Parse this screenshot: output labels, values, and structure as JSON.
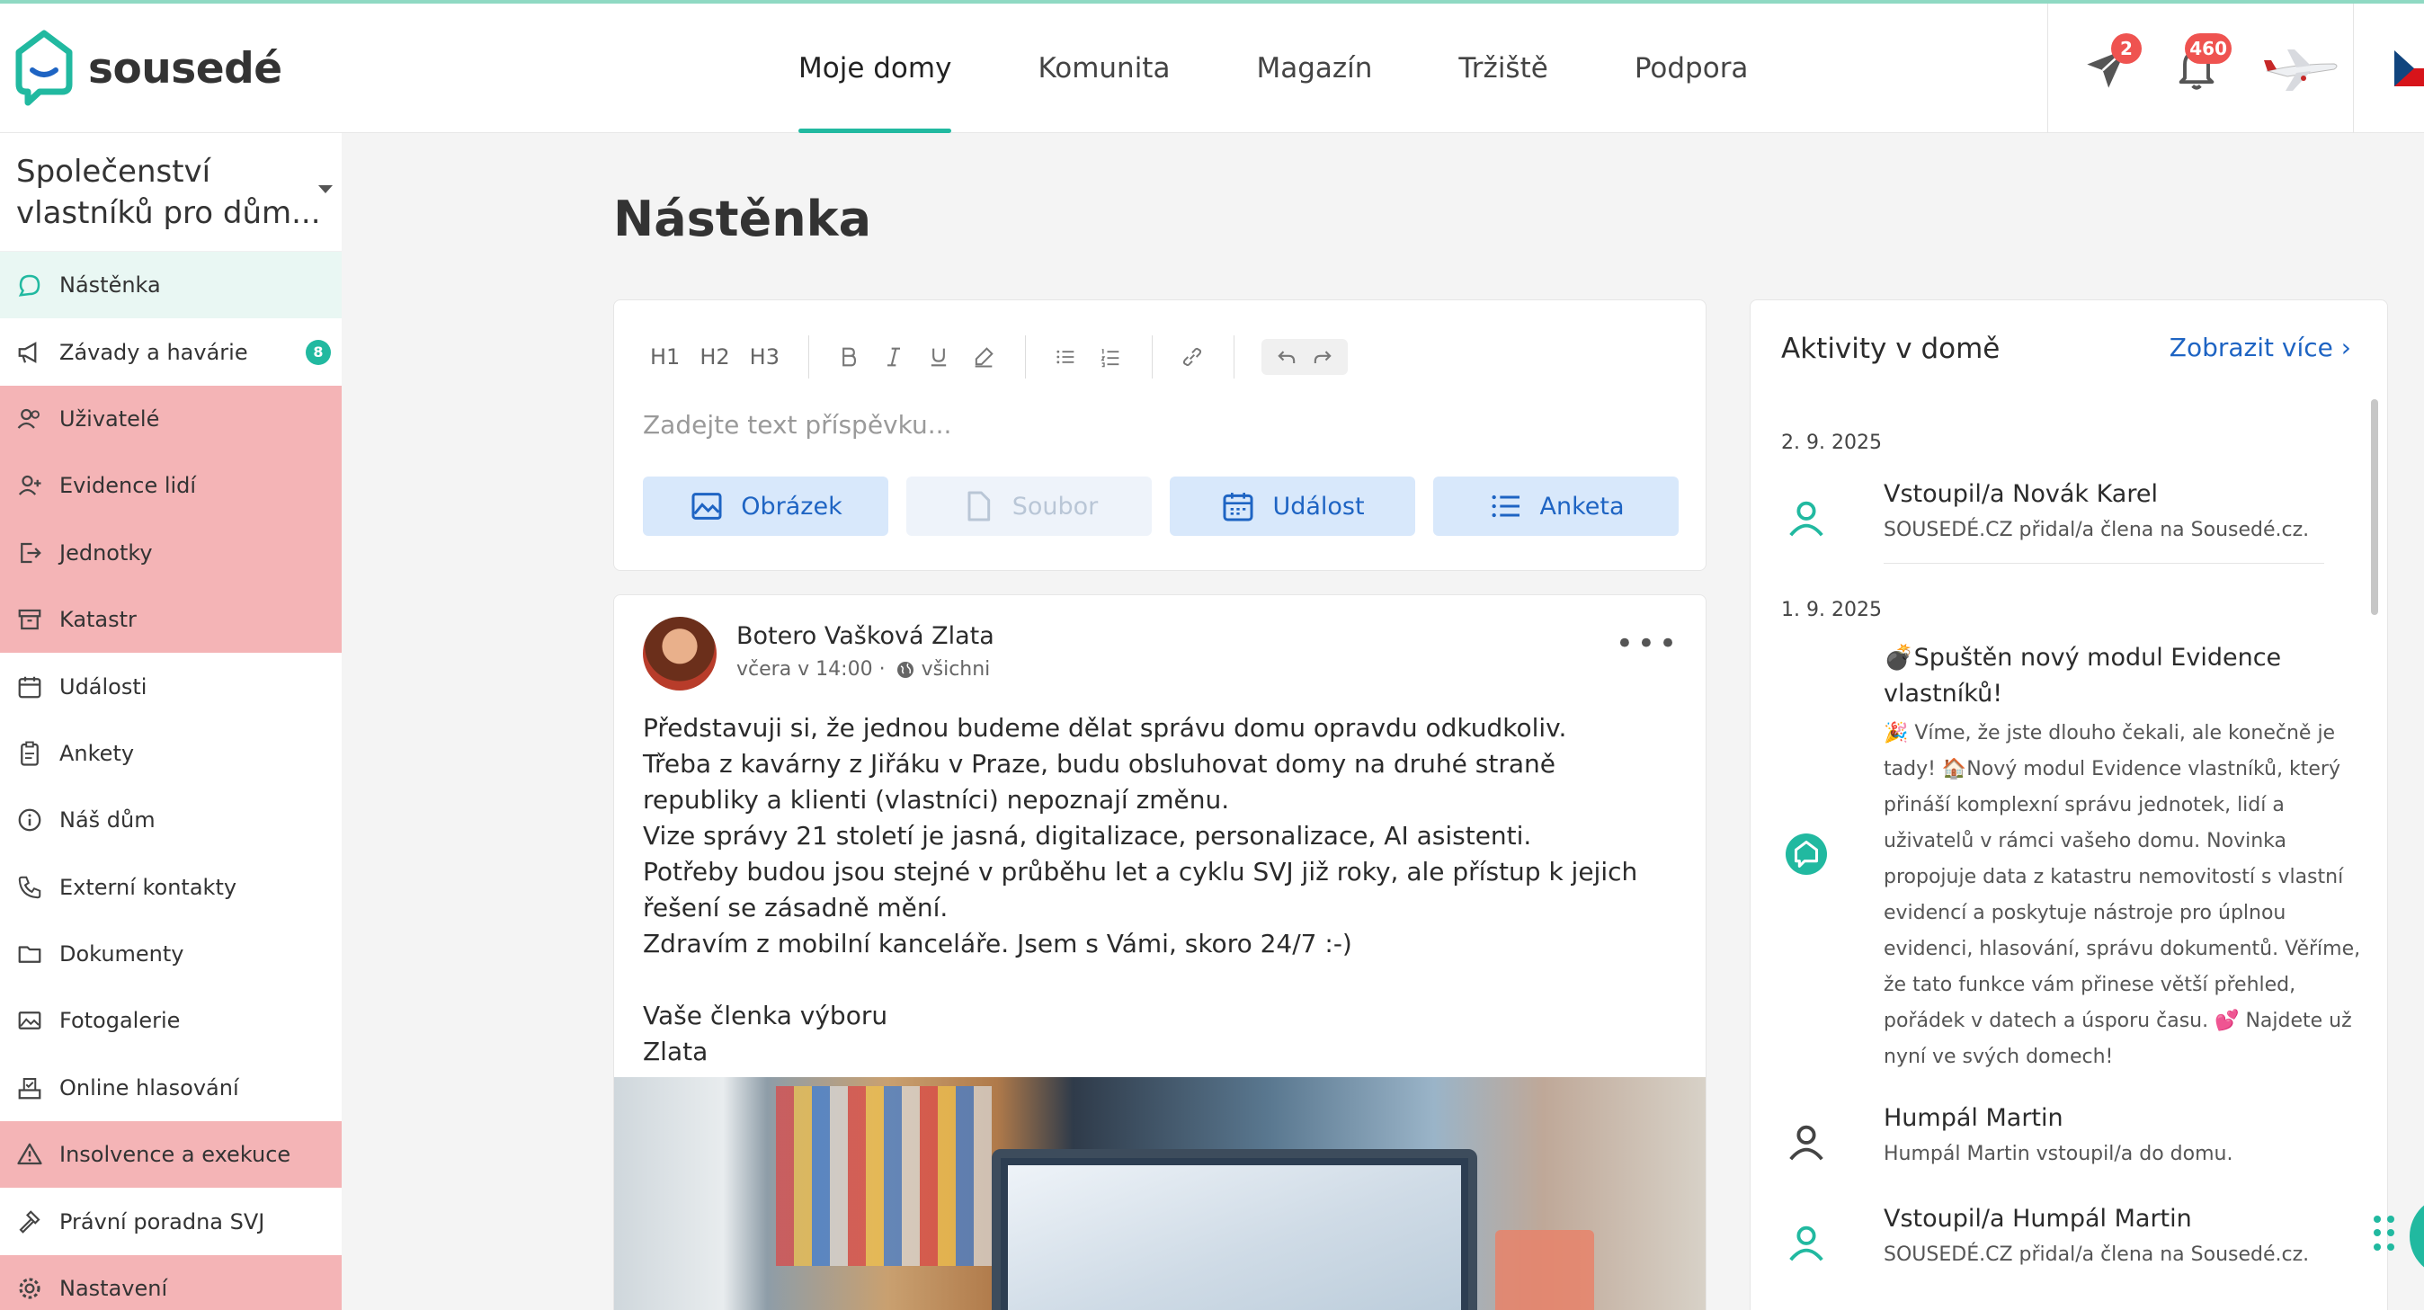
{
  "app": {
    "brand": "sousedé"
  },
  "nav": {
    "items": [
      {
        "label": "Moje domy",
        "active": true
      },
      {
        "label": "Komunita"
      },
      {
        "label": "Magazín"
      },
      {
        "label": "Tržiště"
      },
      {
        "label": "Podpora"
      }
    ]
  },
  "top": {
    "messages_badge": "2",
    "notifications_badge": "460"
  },
  "sidebar": {
    "org_name": "Společenství vlastníků pro dům...",
    "items": [
      {
        "label": "Nástěnka",
        "icon": "chat-bubble-icon",
        "active": true
      },
      {
        "label": "Závady a havárie",
        "icon": "megaphone-icon",
        "badge": "8"
      },
      {
        "label": "Uživatelé",
        "icon": "users-icon",
        "highlighted": true
      },
      {
        "label": "Evidence lidí",
        "icon": "person-add-icon",
        "highlighted": true
      },
      {
        "label": "Jednotky",
        "icon": "door-exit-icon",
        "highlighted": true
      },
      {
        "label": "Katastr",
        "icon": "archive-box-icon",
        "highlighted": true
      },
      {
        "label": "Události",
        "icon": "calendar-icon"
      },
      {
        "label": "Ankety",
        "icon": "clipboard-icon"
      },
      {
        "label": "Náš dům",
        "icon": "info-icon"
      },
      {
        "label": "Externí kontakty",
        "icon": "phone-icon"
      },
      {
        "label": "Dokumenty",
        "icon": "folder-icon"
      },
      {
        "label": "Fotogalerie",
        "icon": "image-icon"
      },
      {
        "label": "Online hlasování",
        "icon": "ballot-box-icon"
      },
      {
        "label": "Insolvence a exekuce",
        "icon": "warning-icon",
        "highlighted": true
      },
      {
        "label": "Právní poradna SVJ",
        "icon": "gavel-icon"
      },
      {
        "label": "Nastavení",
        "icon": "gear-icon",
        "highlighted": true
      }
    ]
  },
  "main": {
    "title": "Nástěnka",
    "composer": {
      "toolbar": [
        "H1",
        "H2",
        "H3"
      ],
      "placeholder": "Zadejte text příspěvku...",
      "buttons": {
        "image": "Obrázek",
        "file": "Soubor",
        "event": "Událost",
        "poll": "Anketa"
      }
    },
    "post": {
      "author": "Botero Vašková Zlata",
      "time": "včera v 14:00",
      "visibility": "všichni",
      "body": "Představuji si, že jednou budeme dělat správu domu opravdu odkudkoliv.\nTřeba z kavárny z Jiřáku v Praze, budu obsluhovat domy na druhé straně republiky a klienti (vlastníci) nepoznají změnu.\nVize správy 21 století je jasná, digitalizace, personalizace, AI asistenti.\nPotřeby budou jsou stejné v průběhu let a cyklu SVJ již roky, ale přístup k jejich řešení se zásadně mění.\nZdravím z mobilní kanceláře. Jsem s Vámi, skoro 24/7 :-)\n\nVaše členka výboru\nZlata"
    }
  },
  "activities": {
    "title": "Aktivity v domě",
    "more_label": "Zobrazit více",
    "groups": [
      {
        "date": "2. 9. 2025",
        "items": [
          {
            "title": "Vstoupil/a Novák Karel",
            "text": "SOUSEDÉ.CZ přidal/a člena na Sousedé.cz.",
            "icon": "person-green-icon"
          }
        ]
      },
      {
        "date": "1. 9. 2025",
        "items": [
          {
            "title": "💣Spuštěn nový modul Evidence vlastníků!",
            "text": "🎉 Víme, že jste dlouho čekali, ale konečně je tady! 🏠Nový modul Evidence vlastníků, který přináší komplexní správu jednotek, lidí a uživatelů v rámci vašeho domu. Novinka propojuje data z katastru nemovitostí s vlastní evidencí a poskytuje nástroje pro úplnou evidenci, hlasování, správu dokumentů. Věříme, že tato funkce vám přinese větší přehled, pořádek v datech a úsporu času. 💕 Najdete už nyní ve svých domech!",
            "icon": "sousede-logo-icon"
          },
          {
            "title": "Humpál Martin",
            "text": "Humpál Martin vstoupil/a do domu.",
            "icon": "person-gray-icon"
          },
          {
            "title": "Vstoupil/a Humpál Martin",
            "text": "SOUSEDÉ.CZ přidal/a člena na Sousedé.cz.",
            "icon": "person-green-icon"
          }
        ]
      }
    ]
  },
  "colors": {
    "accent": "#21b9a0",
    "link": "#1e64c3",
    "highlight": "#f4b4b6",
    "badge": "#ef5350"
  }
}
